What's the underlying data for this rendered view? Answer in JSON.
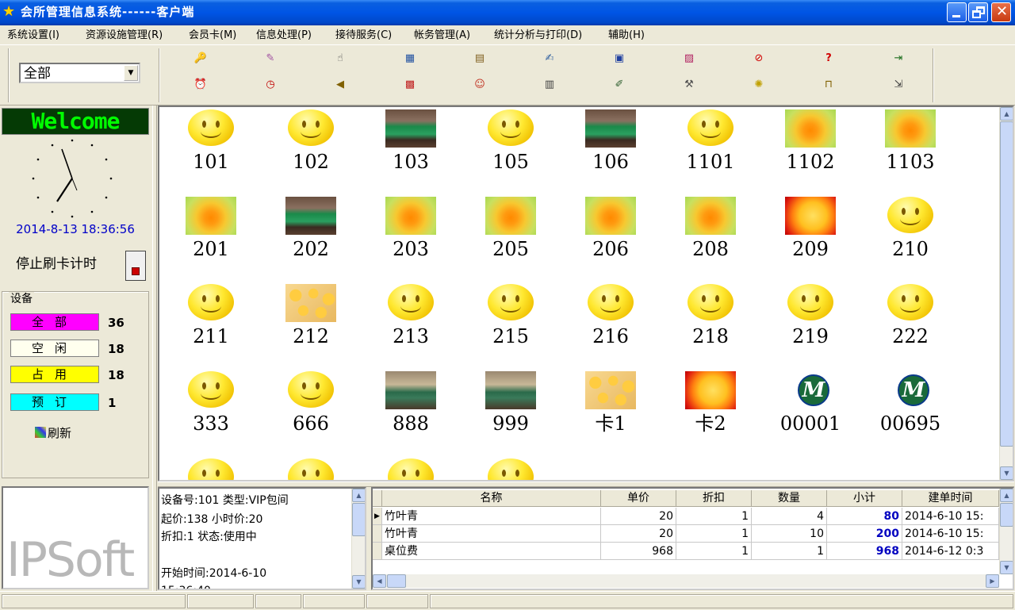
{
  "window": {
    "title": "会所管理信息系统------客户端"
  },
  "menu": [
    "系统设置(I)",
    "资源设施管理(R)",
    "会员卡(M)",
    "信息处理(P)",
    "接待服务(C)",
    "帐务管理(A)",
    "统计分析与打印(D)",
    "辅助(H)"
  ],
  "filter": {
    "selected": "全部"
  },
  "toolbar_icons": [
    "key-icon",
    "paint-icon",
    "hand-icon",
    "calendar-icon",
    "clipboard-icon",
    "edit-icon",
    "table-icon",
    "chart-icon",
    "no-icon",
    "help-icon",
    "export-icon",
    "alarm-icon",
    "clock-icon",
    "speaker-icon",
    "calendar-grid-icon",
    "people-icon",
    "calculator-icon",
    "note-icon",
    "tools-icon",
    "bulb-icon",
    "lock-icon",
    "exit-icon"
  ],
  "left": {
    "welcome": "Welcome",
    "datetime": "2014-8-13 18:36:56",
    "stop_card_label": "停止刷卡计时",
    "device_legend": "设备",
    "stats": [
      {
        "label": "全部",
        "count": "36",
        "color": "#ff00ff"
      },
      {
        "label": "空闲",
        "count": "18",
        "color": "#ffffee"
      },
      {
        "label": "占用",
        "count": "18",
        "color": "#ffff00"
      },
      {
        "label": "预订",
        "count": "1",
        "color": "#00ffff"
      }
    ],
    "refresh_label": "刷新",
    "logo": "IPSoft"
  },
  "rooms": [
    {
      "name": "101",
      "img": "smiley"
    },
    {
      "name": "102",
      "img": "smiley"
    },
    {
      "name": "103",
      "img": "mahjong"
    },
    {
      "name": "105",
      "img": "smiley"
    },
    {
      "name": "106",
      "img": "mahjong"
    },
    {
      "name": "1101",
      "img": "smiley"
    },
    {
      "name": "1102",
      "img": "flower"
    },
    {
      "name": "1103",
      "img": "flower"
    },
    {
      "name": "201",
      "img": "flower"
    },
    {
      "name": "202",
      "img": "mahjong"
    },
    {
      "name": "203",
      "img": "flower"
    },
    {
      "name": "205",
      "img": "flower"
    },
    {
      "name": "206",
      "img": "flower"
    },
    {
      "name": "208",
      "img": "flower"
    },
    {
      "name": "209",
      "img": "rose"
    },
    {
      "name": "210",
      "img": "smiley"
    },
    {
      "name": "211",
      "img": "smiley"
    },
    {
      "name": "212",
      "img": "roses"
    },
    {
      "name": "213",
      "img": "smiley"
    },
    {
      "name": "215",
      "img": "smiley"
    },
    {
      "name": "216",
      "img": "smiley"
    },
    {
      "name": "218",
      "img": "smiley"
    },
    {
      "name": "219",
      "img": "smiley"
    },
    {
      "name": "222",
      "img": "smiley"
    },
    {
      "name": "333",
      "img": "smiley"
    },
    {
      "name": "666",
      "img": "smiley"
    },
    {
      "name": "888",
      "img": "office"
    },
    {
      "name": "999",
      "img": "office"
    },
    {
      "name": "卡1",
      "img": "roses"
    },
    {
      "name": "卡2",
      "img": "rose"
    },
    {
      "name": "00001",
      "img": "mav"
    },
    {
      "name": "00695",
      "img": "mav"
    },
    {
      "name": "",
      "img": "smiley"
    },
    {
      "name": "",
      "img": "smiley"
    },
    {
      "name": "",
      "img": "smiley"
    },
    {
      "name": "",
      "img": "smiley"
    }
  ],
  "info": {
    "line1": "设备号:101    类型:VIP包间",
    "line2": "起价:138     小时价:20",
    "line3": "折扣:1 状态:使用中",
    "line4": "开始时间:2014-6-10",
    "line5": "15:36:40"
  },
  "grid": {
    "headers": [
      "名称",
      "单价",
      "折扣",
      "数量",
      "小计",
      "建单时间"
    ],
    "rows": [
      {
        "name": "竹叶青",
        "price": "20",
        "discount": "1",
        "qty": "4",
        "subtotal": "80",
        "time": "2014-6-10 15:"
      },
      {
        "name": "竹叶青",
        "price": "20",
        "discount": "1",
        "qty": "10",
        "subtotal": "200",
        "time": "2014-6-10 15:"
      },
      {
        "name": "桌位费",
        "price": "968",
        "discount": "1",
        "qty": "1",
        "subtotal": "968",
        "time": "2014-6-12 0:3"
      }
    ]
  }
}
